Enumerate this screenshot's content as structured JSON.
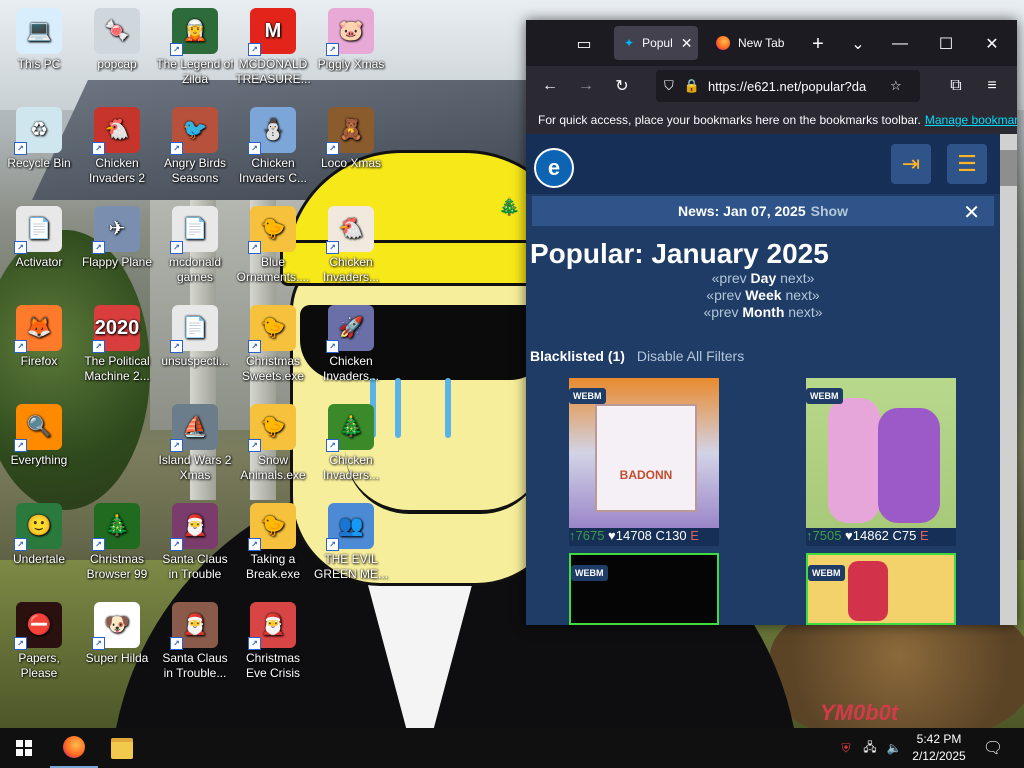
{
  "desktop": {
    "icons": [
      {
        "label": "This PC",
        "glyph": "💻",
        "color": "#d9eefc"
      },
      {
        "label": "popcap",
        "glyph": "🍬",
        "color": "#cfd6dc"
      },
      {
        "label": "The Legend of Zilda",
        "glyph": "🧝",
        "color": "#2d6b3a"
      },
      {
        "label": "MCDONALD TREASURE...",
        "glyph": "M",
        "color": "#e3241b"
      },
      {
        "label": "Piggly Xmas",
        "glyph": "🐷",
        "color": "#e9a9d6"
      },
      {
        "label": "Recycle Bin",
        "glyph": "♻",
        "color": "#cfe6ee"
      },
      {
        "label": "Chicken Invaders 2",
        "glyph": "🐔",
        "color": "#c7342b"
      },
      {
        "label": "Angry Birds Seasons",
        "glyph": "🐦",
        "color": "#b8513b"
      },
      {
        "label": "Chicken Invaders C...",
        "glyph": "⛄",
        "color": "#7da6d8"
      },
      {
        "label": "Loco Xmas",
        "glyph": "🧸",
        "color": "#8a5b2d"
      },
      {
        "label": "Activator",
        "glyph": "📄",
        "color": "#e8e8e8"
      },
      {
        "label": "Flappy Plane",
        "glyph": "✈",
        "color": "#7a8fb0"
      },
      {
        "label": "mcdonald games",
        "glyph": "📄",
        "color": "#e8e8e8"
      },
      {
        "label": "Blue Ornaments....",
        "glyph": "🐤",
        "color": "#f6c23e"
      },
      {
        "label": "Chicken Invaders...",
        "glyph": "🐔",
        "color": "#f1e9dd"
      },
      {
        "label": "Firefox",
        "glyph": "🦊",
        "color": "#ff7a2b"
      },
      {
        "label": "The Political Machine 2...",
        "glyph": "2020",
        "color": "#d93d3d"
      },
      {
        "label": "unsuspecti...",
        "glyph": "📄",
        "color": "#e8e8e8"
      },
      {
        "label": "Christmas Sweets.exe",
        "glyph": "🐤",
        "color": "#f6c23e"
      },
      {
        "label": "Chicken Invaders...",
        "glyph": "🚀",
        "color": "#6a6fa8"
      },
      {
        "label": "Everything",
        "glyph": "🔍",
        "color": "#ff8a00"
      },
      {
        "label": "Island Wars 2 Xmas",
        "glyph": "⛵",
        "color": "#6b7c8a"
      },
      {
        "label": "Snow Animals.exe",
        "glyph": "🐤",
        "color": "#f6c23e"
      },
      {
        "label": "Chicken Invaders...",
        "glyph": "🎄",
        "color": "#3a8a2a"
      },
      {
        "label": "Undertale",
        "glyph": "🙂",
        "color": "#2b7a3d"
      },
      {
        "label": "Christmas Browser 99",
        "glyph": "🎄",
        "color": "#1f6b1f"
      },
      {
        "label": "Santa Claus in Trouble",
        "glyph": "🎅",
        "color": "#7a3d6b"
      },
      {
        "label": "Taking a Break.exe",
        "glyph": "🐤",
        "color": "#f6c23e"
      },
      {
        "label": "THE EVIL GREEN ME...",
        "glyph": "👥",
        "color": "#4d8ad6"
      },
      {
        "label": "Papers, Please",
        "glyph": "⛔",
        "color": "#2b1010"
      },
      {
        "label": "Super Hilda",
        "glyph": "🐶",
        "color": "#ffffff"
      },
      {
        "label": "Santa Claus in Trouble... A...",
        "glyph": "🎅",
        "color": "#8a5b4a"
      },
      {
        "label": "Christmas Eve Crisis",
        "glyph": "🎅",
        "color": "#d84545"
      }
    ]
  },
  "browser": {
    "tabs": [
      {
        "label": "Popul",
        "active": true
      },
      {
        "label": "New Tab",
        "active": false
      }
    ],
    "url": "https://e621.net/popular?da",
    "bookmarks_hint": "For quick access, place your bookmarks here on the bookmarks toolbar.",
    "bookmarks_link": "Manage bookmarks",
    "site": {
      "news_text": "News: Jan 07, 2025",
      "news_show": "Show",
      "title": "Popular: January 2025",
      "period_rows": [
        {
          "prev": "«prev",
          "label": "Day",
          "next": "next»"
        },
        {
          "prev": "«prev",
          "label": "Week",
          "next": "next»"
        },
        {
          "prev": "«prev",
          "label": "Month",
          "next": "next»"
        }
      ],
      "blacklisted": "Blacklisted (1)",
      "disable_filters": "Disable All Filters",
      "posts": [
        {
          "badge": "WEBM",
          "score": "↑7675",
          "favs": "♥14708",
          "comments": "C130",
          "rating": "E",
          "poster_text": "BADONN"
        },
        {
          "badge": "WEBM",
          "score": "↑7505",
          "favs": "♥14862",
          "comments": "C75",
          "rating": "E",
          "poster_text": ""
        },
        {
          "badge": "WEBM",
          "score": "",
          "favs": "",
          "comments": "",
          "rating": "",
          "poster_text": ""
        },
        {
          "badge": "WEBM",
          "score": "",
          "favs": "",
          "comments": "",
          "rating": "",
          "poster_text": ""
        }
      ]
    }
  },
  "taskbar": {
    "time": "5:42 PM",
    "date": "2/12/2025"
  },
  "wallpaper": {
    "sign_text": "YM0b0t"
  }
}
